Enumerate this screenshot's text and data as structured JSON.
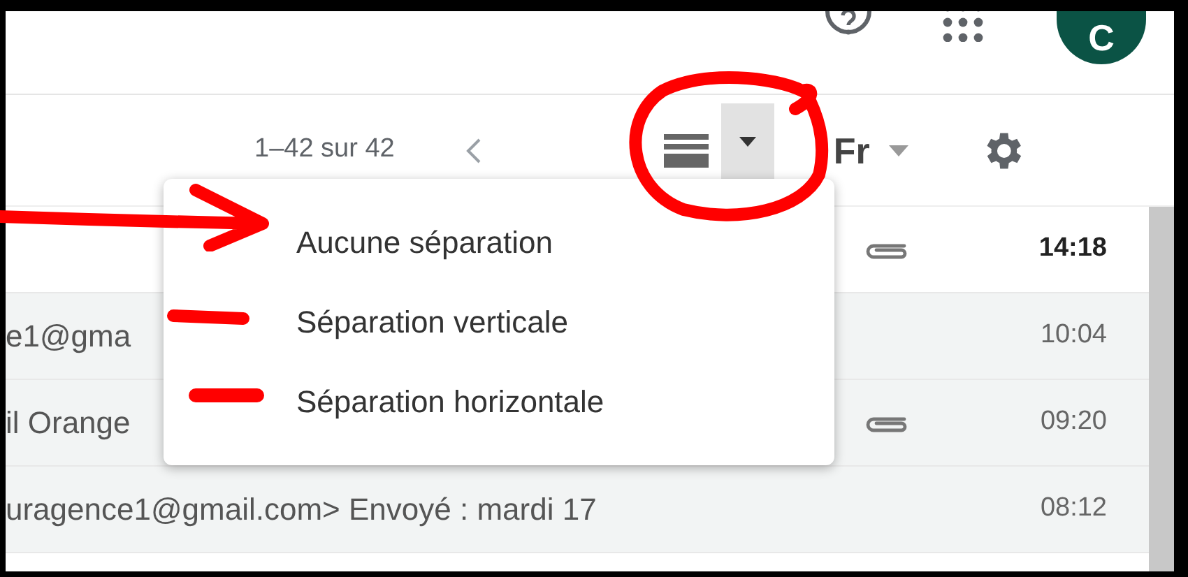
{
  "toolbar": {
    "pagination": "1–42 sur 42",
    "input_tool": "Fr"
  },
  "avatar": {
    "initial": "C"
  },
  "emails": [
    {
      "unread": true,
      "attachment": true,
      "time": "14:18"
    },
    {
      "unread": false,
      "attachment": false,
      "sender": "e1@gma",
      "time": "10:04"
    },
    {
      "unread": false,
      "attachment": true,
      "sender": "il Orange",
      "time": "09:20"
    },
    {
      "unread": false,
      "attachment": false,
      "sender": "uragence1@gmail.com> Envoyé : mardi 17",
      "time": "08:12"
    }
  ],
  "split_menu": {
    "items": [
      {
        "label": "Aucune séparation"
      },
      {
        "label": "Séparation verticale"
      },
      {
        "label": "Séparation horizontale"
      }
    ]
  }
}
